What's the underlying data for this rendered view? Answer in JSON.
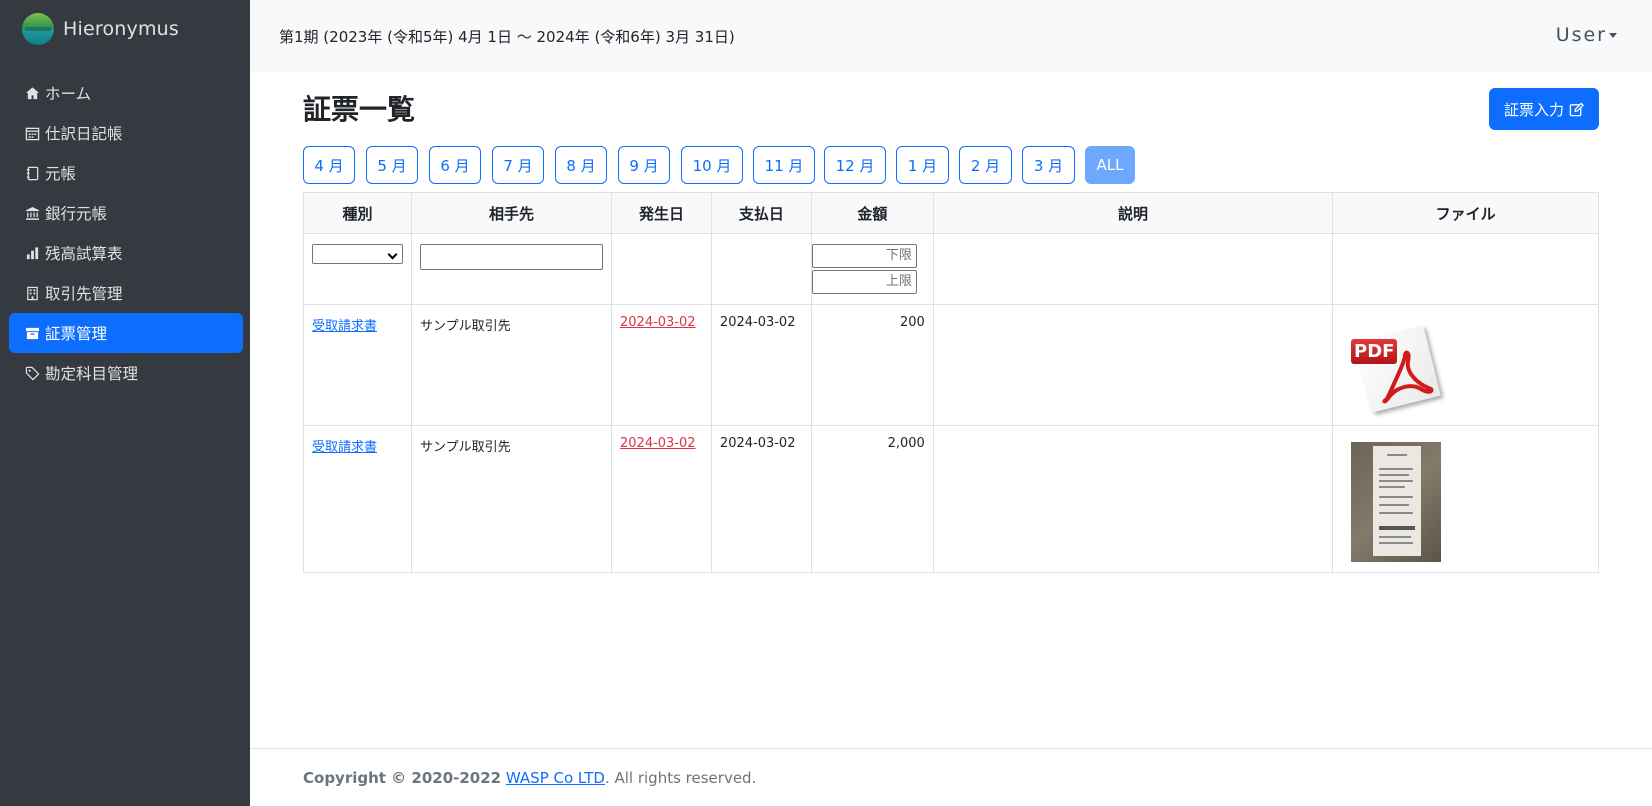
{
  "brand": {
    "name": "Hieronymus"
  },
  "sidebar": {
    "items": [
      {
        "label": "ホーム",
        "icon": "house-icon",
        "active": false
      },
      {
        "label": "仕訳日記帳",
        "icon": "calendar-icon",
        "active": false
      },
      {
        "label": "元帳",
        "icon": "journal-icon",
        "active": false
      },
      {
        "label": "銀行元帳",
        "icon": "bank-icon",
        "active": false
      },
      {
        "label": "残高試算表",
        "icon": "bar-chart-icon",
        "active": false
      },
      {
        "label": "取引先管理",
        "icon": "building-icon",
        "active": false
      },
      {
        "label": "証票管理",
        "icon": "archive-icon",
        "active": true
      },
      {
        "label": "勘定科目管理",
        "icon": "tag-icon",
        "active": false
      }
    ]
  },
  "header": {
    "period": "第1期 (2023年 (令和5年) 4月 1日 〜 2024年 (令和6年) 3月 31日)",
    "user": "User"
  },
  "main": {
    "title": "証票一覧",
    "new_button": "証票入力",
    "months": [
      "4 月",
      "5 月",
      "6 月",
      "7 月",
      "8 月",
      "9 月",
      "10 月",
      "11 月",
      "12 月",
      "1 月",
      "2 月",
      "3 月",
      "ALL"
    ],
    "active_month": "ALL",
    "table": {
      "columns": [
        "種別",
        "相手先",
        "発生日",
        "支払日",
        "金額",
        "説明",
        "ファイル"
      ],
      "filters": {
        "amount_min_placeholder": "下限",
        "amount_max_placeholder": "上限"
      },
      "rows": [
        {
          "type": "受取請求書",
          "partner": "サンプル取引先",
          "occurred": "2024-03-02",
          "paid": "2024-03-02",
          "amount": "200",
          "description": "",
          "file": "pdf"
        },
        {
          "type": "受取請求書",
          "partner": "サンプル取引先",
          "occurred": "2024-03-02",
          "paid": "2024-03-02",
          "amount": "2,000",
          "description": "",
          "file": "image"
        }
      ]
    }
  },
  "footer": {
    "copyright": "Copyright © 2020-2022",
    "company": "WASP Co LTD",
    "rights": ". All rights reserved."
  },
  "colors": {
    "sidebar": "#343a40",
    "accent": "#0d6efd",
    "danger": "#dc3545"
  }
}
